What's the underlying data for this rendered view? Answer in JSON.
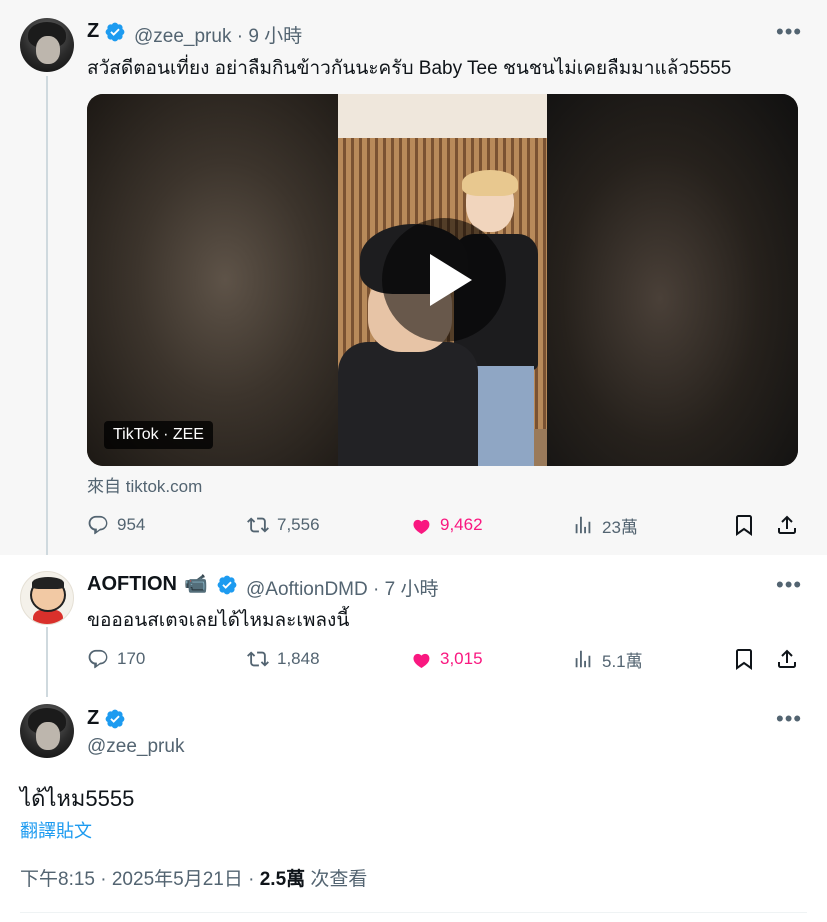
{
  "tweet1": {
    "name": "Z",
    "handle": "@zee_pruk · 9 小時",
    "text": "สวัสดีตอนเที่ยง อย่าลืมกินข้าวกันนะครับ Baby Tee ชนชนไม่เคยลืมมาแล้ว5555",
    "media_tag": "TikTok · ZEE",
    "source": "來自 tiktok.com",
    "replies": "954",
    "retweets": "7,556",
    "likes": "9,462",
    "views": "23萬"
  },
  "tweet2": {
    "name": "AOFTION",
    "name_emoji": "📹",
    "handle": "@AoftionDMD · 7 小時",
    "text": "ขอออนสเตจเลยได้ไหมละเพลงนี้",
    "replies": "170",
    "retweets": "1,848",
    "likes": "3,015",
    "views": "5.1萬"
  },
  "tweet3": {
    "name": "Z",
    "handle": "@zee_pruk",
    "text": "ได้ไหม5555",
    "translate": "翻譯貼文",
    "timestamp": "下午8:15 · 2025年5月21日 · ",
    "view_count": "2.5萬",
    "view_label": " 次查看"
  },
  "more_glyph": "•••",
  "colors": {
    "verified": "#1d9bf0",
    "like": "#f91880",
    "muted": "#536471"
  }
}
